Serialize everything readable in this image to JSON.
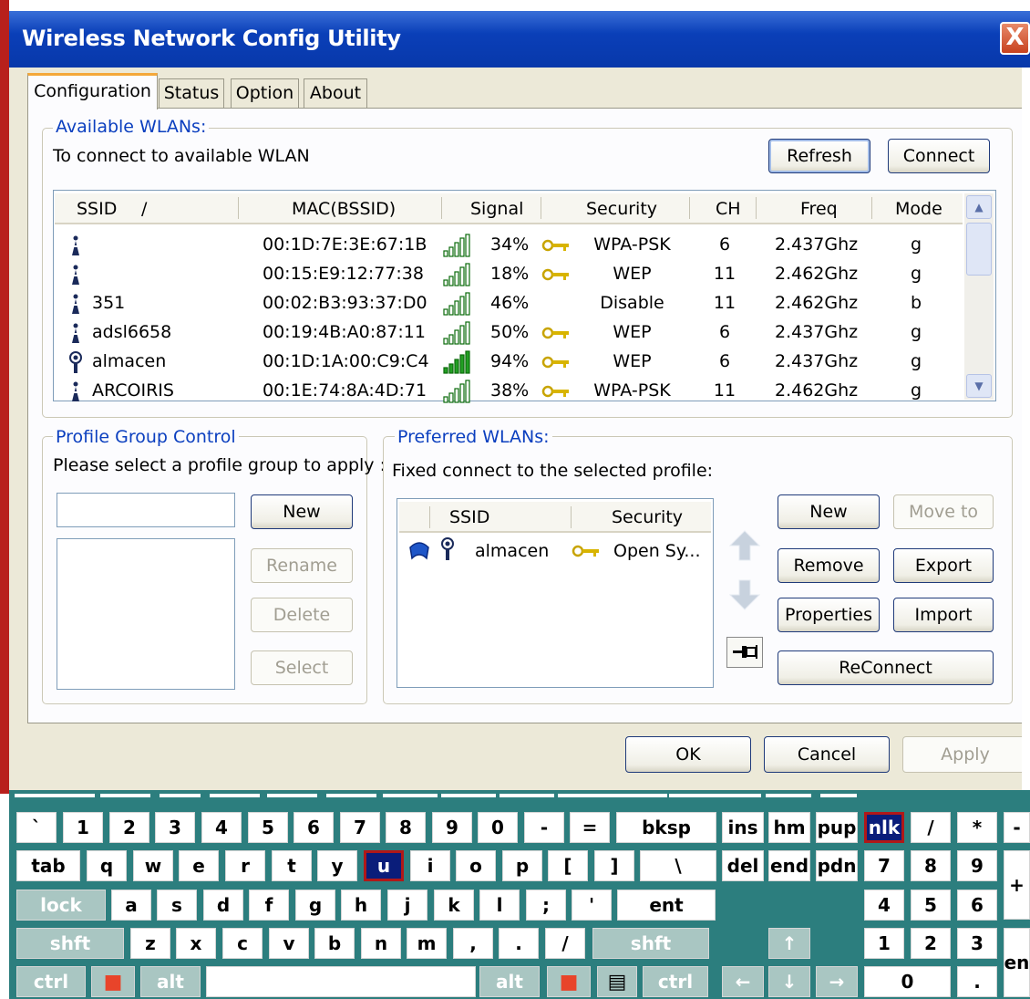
{
  "window": {
    "title": "Wireless Network Config Utility",
    "close_glyph": "X"
  },
  "tabs": [
    "Configuration",
    "Status",
    "Option",
    "About"
  ],
  "available": {
    "group_label": "Available WLANs:",
    "instruction": "To connect to available WLAN",
    "refresh_label": "Refresh",
    "connect_label": "Connect",
    "columns": [
      "SSID",
      "/",
      "MAC(BSSID)",
      "Signal",
      "Security",
      "CH",
      "Freq",
      "Mode"
    ],
    "rows": [
      {
        "ssid": "",
        "mac": "00:1D:7E:3E:67:1B",
        "signal": "34%",
        "key": true,
        "security": "WPA-PSK",
        "ch": "6",
        "freq": "2.437Ghz",
        "mode": "g",
        "icon": "antenna-icon"
      },
      {
        "ssid": "",
        "mac": "00:15:E9:12:77:38",
        "signal": "18%",
        "key": true,
        "security": "WEP",
        "ch": "11",
        "freq": "2.462Ghz",
        "mode": "g",
        "icon": "antenna-icon"
      },
      {
        "ssid": "351",
        "mac": "00:02:B3:93:37:D0",
        "signal": "46%",
        "key": false,
        "security": "Disable",
        "ch": "11",
        "freq": "2.462Ghz",
        "mode": "b",
        "icon": "antenna-icon"
      },
      {
        "ssid": "adsl6658",
        "mac": "00:19:4B:A0:87:11",
        "signal": "50%",
        "key": true,
        "security": "WEP",
        "ch": "6",
        "freq": "2.437Ghz",
        "mode": "g",
        "icon": "antenna-icon"
      },
      {
        "ssid": "almacen",
        "mac": "00:1D:1A:00:C9:C4",
        "signal": "94%",
        "key": true,
        "security": "WEP",
        "ch": "6",
        "freq": "2.437Ghz",
        "mode": "g",
        "icon": "connected-antenna-icon"
      },
      {
        "ssid": "ARCOIRIS",
        "mac": "00:1E:74:8A:4D:71",
        "signal": "38%",
        "key": true,
        "security": "WPA-PSK",
        "ch": "11",
        "freq": "2.462Ghz",
        "mode": "g",
        "icon": "antenna-icon"
      }
    ]
  },
  "profile_group": {
    "group_label": "Profile Group Control",
    "instruction": "Please select a profile group to apply :",
    "input_value": "",
    "new_label": "New",
    "rename_label": "Rename",
    "delete_label": "Delete",
    "select_label": "Select"
  },
  "preferred": {
    "group_label": "Preferred WLANs:",
    "instruction": "Fixed connect to the selected profile:",
    "columns": [
      "SSID",
      "Security"
    ],
    "rows": [
      {
        "ssid": "almacen",
        "security": "Open Sy..."
      }
    ],
    "new_label": "New",
    "move_to_label": "Move to",
    "remove_label": "Remove",
    "export_label": "Export",
    "properties_label": "Properties",
    "import_label": "Import",
    "reconnect_label": "ReConnect"
  },
  "dialog_buttons": {
    "ok": "OK",
    "cancel": "Cancel",
    "apply": "Apply"
  },
  "keyboard": {
    "row1": [
      "`",
      "1",
      "2",
      "3",
      "4",
      "5",
      "6",
      "7",
      "8",
      "9",
      "0",
      "-",
      "=",
      "bksp"
    ],
    "row2": [
      "tab",
      "q",
      "w",
      "e",
      "r",
      "t",
      "y",
      "u",
      "i",
      "o",
      "p",
      "[",
      "]",
      "\\"
    ],
    "row3": [
      "lock",
      "a",
      "s",
      "d",
      "f",
      "g",
      "h",
      "j",
      "k",
      "l",
      ";",
      "'",
      "ent"
    ],
    "row4": [
      "shft",
      "z",
      "x",
      "c",
      "v",
      "b",
      "n",
      "m",
      ",",
      ".",
      "/",
      "shft"
    ],
    "row5": [
      "ctrl",
      "alt",
      "alt",
      "ctrl"
    ],
    "nav1": [
      "ins",
      "hm",
      "pup"
    ],
    "nav2": [
      "del",
      "end",
      "pdn"
    ],
    "numpad_row1": [
      "nlk",
      "/",
      "*",
      "-"
    ],
    "numpad_row2": [
      "7",
      "8",
      "9"
    ],
    "numpad_row3": [
      "4",
      "5",
      "6",
      "+"
    ],
    "numpad_row4": [
      "1",
      "2",
      "3"
    ],
    "numpad_row5": [
      "0",
      ".",
      "en"
    ],
    "colors": {
      "background": "#2c7e7e",
      "modifier": "#a9c6c2",
      "active": "#0a1d7a"
    }
  }
}
